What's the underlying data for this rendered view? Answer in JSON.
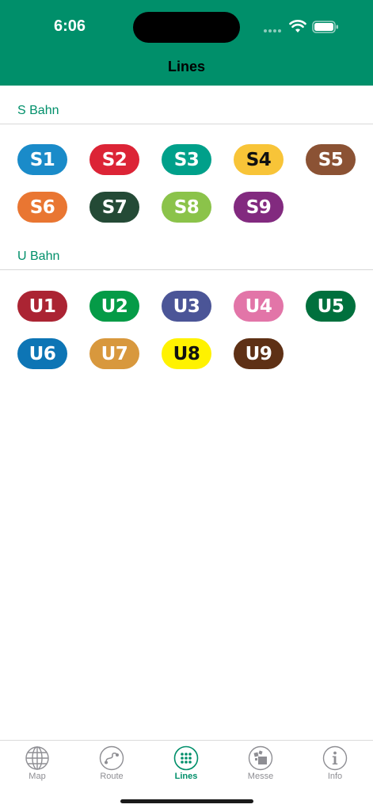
{
  "status_bar": {
    "time": "6:06"
  },
  "nav": {
    "title": "Lines"
  },
  "sections": [
    {
      "header": "S Bahn",
      "lines": [
        {
          "label": "S1",
          "bg": "#1a8bc9",
          "fg": "#ffffff"
        },
        {
          "label": "S2",
          "bg": "#dc2436",
          "fg": "#ffffff"
        },
        {
          "label": "S3",
          "bg": "#00a08a",
          "fg": "#ffffff"
        },
        {
          "label": "S4",
          "bg": "#f8c438",
          "fg": "#111111"
        },
        {
          "label": "S5",
          "bg": "#8b5234",
          "fg": "#ffffff"
        },
        {
          "label": "S6",
          "bg": "#e97632",
          "fg": "#ffffff"
        },
        {
          "label": "S7",
          "bg": "#244a36",
          "fg": "#ffffff"
        },
        {
          "label": "S8",
          "bg": "#8bc34a",
          "fg": "#ffffff"
        },
        {
          "label": "S9",
          "bg": "#822a7f",
          "fg": "#ffffff"
        }
      ]
    },
    {
      "header": "U Bahn",
      "lines": [
        {
          "label": "U1",
          "bg": "#ab2433",
          "fg": "#ffffff"
        },
        {
          "label": "U2",
          "bg": "#059b47",
          "fg": "#ffffff"
        },
        {
          "label": "U3",
          "bg": "#4b5597",
          "fg": "#ffffff"
        },
        {
          "label": "U4",
          "bg": "#e275a8",
          "fg": "#ffffff"
        },
        {
          "label": "U5",
          "bg": "#00703d",
          "fg": "#ffffff"
        },
        {
          "label": "U6",
          "bg": "#0d75b5",
          "fg": "#ffffff"
        },
        {
          "label": "U7",
          "bg": "#d8983d",
          "fg": "#ffffff"
        },
        {
          "label": "U8",
          "bg": "#fff200",
          "fg": "#111111"
        },
        {
          "label": "U9",
          "bg": "#5e3015",
          "fg": "#ffffff"
        }
      ]
    }
  ],
  "tabbar": {
    "active": "lines",
    "tabs": [
      {
        "id": "map",
        "label": "Map",
        "icon": "globe-icon"
      },
      {
        "id": "route",
        "label": "Route",
        "icon": "route-icon"
      },
      {
        "id": "lines",
        "label": "Lines",
        "icon": "grid-dots-icon"
      },
      {
        "id": "messe",
        "label": "Messe",
        "icon": "messe-icon"
      },
      {
        "id": "info",
        "label": "Info",
        "icon": "info-icon"
      }
    ]
  },
  "colors": {
    "accent": "#008f6a",
    "inactive": "#8e8e93"
  }
}
